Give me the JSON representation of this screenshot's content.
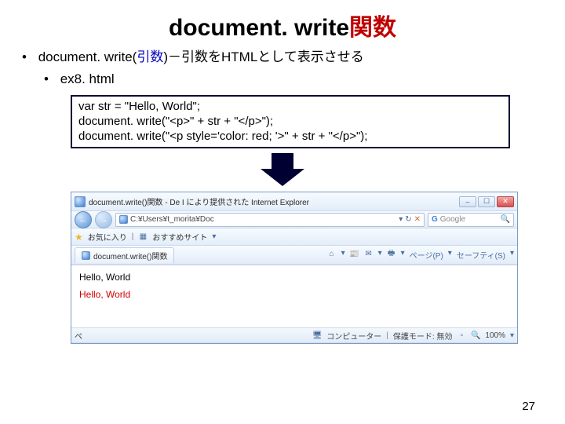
{
  "title": {
    "prefix": "document. write",
    "suffix": "関数"
  },
  "bullets": {
    "b1_black": "document. write(",
    "b1_blue": "引数",
    "b1_tail": ")－引数をHTMLとして表示させる",
    "b2": "ex8. html"
  },
  "code": {
    "l1": "var str = \"Hello, World\";",
    "l2": "document. write(\"<p>\" + str + \"</p>\");",
    "l3": "document. write(\"<p style='color: red; '>\" + str + \"</p>\");"
  },
  "browser": {
    "window_title": "document.write()関数 - De I により提供された Internet Explorer",
    "address": "C:¥Users¥t_morita¥Doc",
    "search_placeholder": "Google",
    "favorites_label": "お気に入り",
    "favorites_item": "おすすめサイト",
    "tab_label": "document.write()関数",
    "toolbar": {
      "home": "ホーム",
      "feed": "フィード",
      "mail": "メール",
      "print": "印刷",
      "page": "ページ(P)",
      "safety": "セーフティ(S)"
    },
    "content_line1": "Hello, World",
    "content_line2": "Hello, World",
    "status": {
      "left_icon_label": "ペ",
      "computer": "コンピューター",
      "protected_mode": "保護モード: 無効",
      "zoom": "100%"
    }
  },
  "page_number": "27"
}
